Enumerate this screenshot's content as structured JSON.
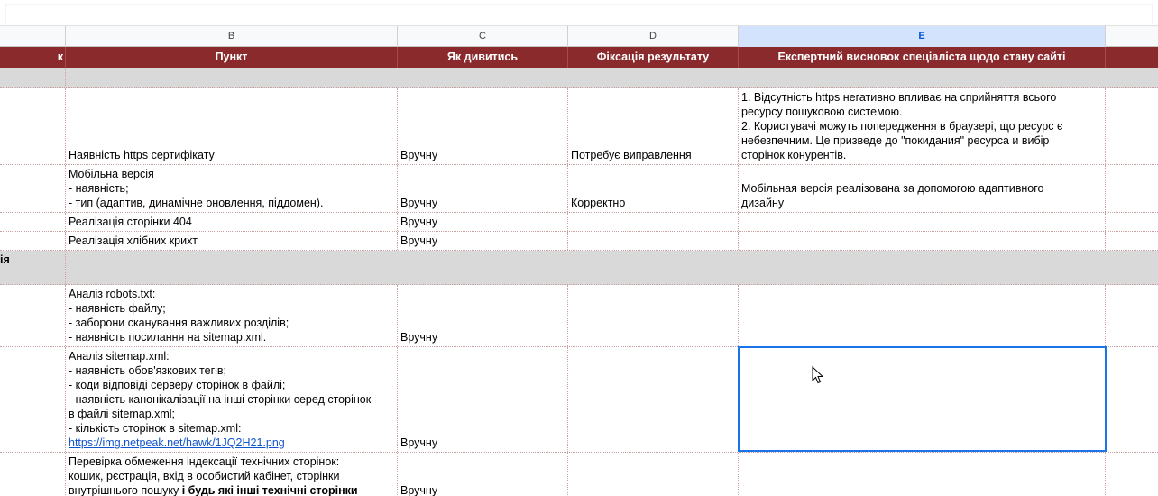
{
  "columns": {
    "A": "",
    "B": "B",
    "C": "C",
    "D": "D",
    "E": "E"
  },
  "header": {
    "a_tail": "к",
    "b": "Пункт",
    "c": "Як дивитись",
    "d": "Фіксація результату",
    "e": "Експертний висновок спеціаліста щодо стану сайті"
  },
  "rows": {
    "https": {
      "b": "Наявність https сертифікату",
      "c": "Вручну",
      "d": "Потребує виправлення",
      "e_lines": [
        "1. Відсутність https негативно впливає на сприйняття всього",
        "ресурсу пошуковою системою.",
        "2. Користувачі можуть попередження в браузері, що ресурс є",
        "небезпечним. Це призведе до \"покидания\" ресурса и вибір",
        "сторінок конурентів."
      ]
    },
    "mobile": {
      "b_lines": [
        "Мобільна версія",
        "- наявність;",
        "- тип (адаптив, динамічне оновлення, піддомен)."
      ],
      "c": "Вручну",
      "d": "Корректно",
      "e_lines": [
        "Мобільная версія реалізована за допомогою адаптивного",
        "дизайну"
      ]
    },
    "page404": {
      "b": "Реалізація сторінки 404",
      "c": "Вручну"
    },
    "breadcrumbs": {
      "b": "Реалізація хлібних крихт",
      "c": "Вручну"
    },
    "section2": {
      "a_tail": "ія"
    },
    "robots": {
      "b_lines": [
        "Аналіз robots.txt:",
        "- наявність файлу;",
        "- заборони сканування важливих розділів;",
        "- наявність посилання на sitemap.xml."
      ],
      "c": "Вручну"
    },
    "sitemap": {
      "b_lines": [
        "Аналіз sitemap.xml:",
        "- наявність обов'язкових тегів;",
        "- коди відповіді серверу сторінок в файлі;",
        "- наявність канонікалізації на інші сторінки серед сторінок",
        "в файлі sitemap.xml;",
        "- кількість сторінок в sitemap.xml:"
      ],
      "b_link": "https://img.netpeak.net/hawk/1JQ2H21.png",
      "c": "Вручну"
    },
    "tech": {
      "b_line1": "Перевірка обмеження індексації технічних сторінок:",
      "b_line2": "кошик, рєстрація, вхід в особистий кабінет, сторінки",
      "b_line3_normal": "внутрішнього пошуку ",
      "b_line3_bold": "і будь які інші технічні сторінки",
      "c": "Вручну"
    }
  },
  "colors": {
    "header_bg": "#8b2a2d",
    "section_bg": "#d9d9d9",
    "selection_border": "#1a73e8",
    "link": "#1155cc"
  }
}
